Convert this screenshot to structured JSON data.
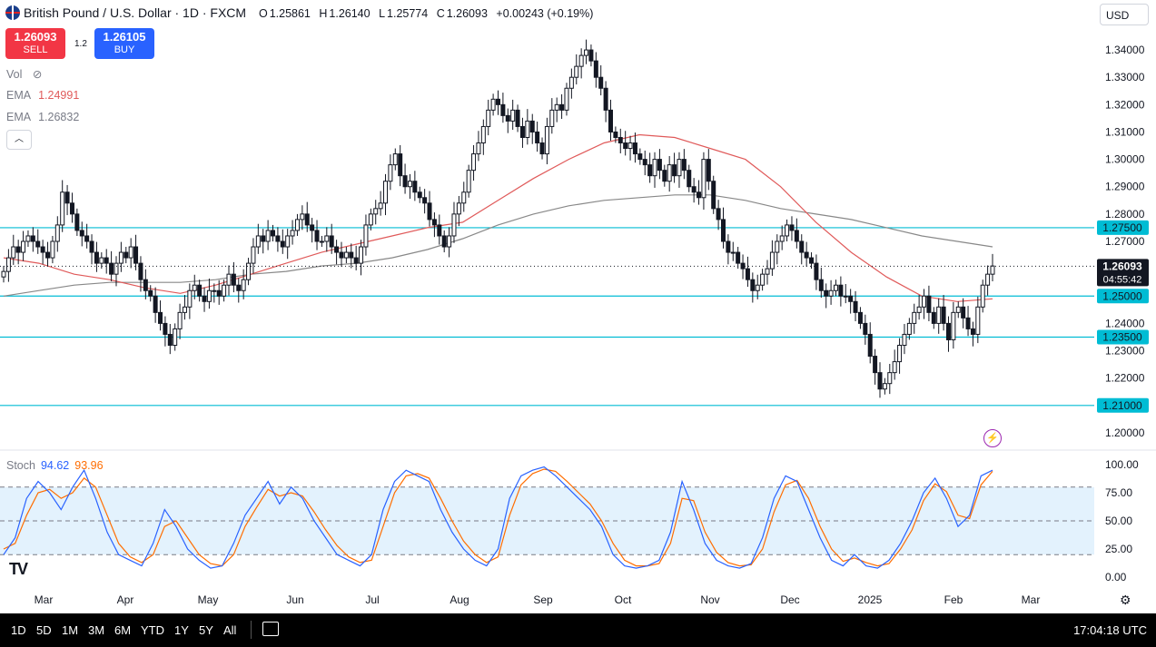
{
  "header": {
    "symbol_title": "British Pound / U.S. Dollar · 1D · FXCM",
    "open_label": "O",
    "open": "1.25861",
    "high_label": "H",
    "high": "1.26140",
    "low_label": "L",
    "low": "1.25774",
    "close_label": "C",
    "close": "1.26093",
    "change": "+0.00243 (+0.19%)"
  },
  "trade": {
    "sell_price": "1.26093",
    "sell_label": "SELL",
    "spread": "1.2",
    "buy_price": "1.26105",
    "buy_label": "BUY"
  },
  "indicators": {
    "vol_label": "Vol",
    "ema1_label": "EMA",
    "ema1_value": "1.24991",
    "ema2_label": "EMA",
    "ema2_value": "1.26832"
  },
  "currency": "USD",
  "stoch": {
    "label": "Stoch",
    "k": "94.62",
    "d": "93.96"
  },
  "price_tag": {
    "price": "1.26093",
    "countdown": "04:55:42"
  },
  "bottombar": {
    "ranges": [
      "1D",
      "5D",
      "1M",
      "3M",
      "6M",
      "YTD",
      "1Y",
      "5Y",
      "All"
    ],
    "clock": "17:04:18 UTC"
  },
  "colors": {
    "up": "#131722",
    "down": "#131722",
    "ema_fast": "#e05a5a",
    "ema_slow": "#888888",
    "hline": "#00bcd4",
    "stoch_k": "#2962ff",
    "stoch_d": "#ff6d00",
    "stoch_band": "#e3f2fd",
    "tag_bg": "#00bcd4",
    "last_bg": "#131722"
  },
  "chart_data": {
    "type": "candlestick",
    "x_labels": [
      "Mar",
      "Apr",
      "May",
      "Jun",
      "Jul",
      "Aug",
      "Sep",
      "Oct",
      "Nov",
      "Dec",
      "2025",
      "Feb",
      "Mar"
    ],
    "y_ticks": [
      "1.34000",
      "1.33000",
      "1.32000",
      "1.31000",
      "1.30000",
      "1.29000",
      "1.28000",
      "1.27000",
      "1.26000",
      "1.25000",
      "1.24000",
      "1.23000",
      "1.22000",
      "1.21000",
      "1.20000"
    ],
    "ylim": [
      1.195,
      1.345
    ],
    "horizontal_levels": [
      {
        "value": 1.275,
        "label": "1.27500"
      },
      {
        "value": 1.25,
        "label": "1.25000"
      },
      {
        "value": 1.235,
        "label": "1.23500"
      },
      {
        "value": 1.21,
        "label": "1.21000"
      }
    ],
    "close_path": [
      1.259,
      1.264,
      1.268,
      1.266,
      1.27,
      1.272,
      1.27,
      1.268,
      1.266,
      1.264,
      1.27,
      1.276,
      1.288,
      1.284,
      1.28,
      1.274,
      1.272,
      1.27,
      1.266,
      1.262,
      1.264,
      1.262,
      1.258,
      1.262,
      1.266,
      1.264,
      1.268,
      1.262,
      1.256,
      1.252,
      1.25,
      1.244,
      1.24,
      1.236,
      1.232,
      1.238,
      1.244,
      1.246,
      1.252,
      1.254,
      1.25,
      1.248,
      1.252,
      1.252,
      1.25,
      1.254,
      1.258,
      1.254,
      1.252,
      1.256,
      1.262,
      1.268,
      1.272,
      1.27,
      1.274,
      1.272,
      1.27,
      1.268,
      1.272,
      1.274,
      1.278,
      1.28,
      1.276,
      1.274,
      1.27,
      1.27,
      1.272,
      1.268,
      1.266,
      1.264,
      1.266,
      1.264,
      1.262,
      1.268,
      1.276,
      1.28,
      1.282,
      1.284,
      1.292,
      1.298,
      1.302,
      1.294,
      1.29,
      1.292,
      1.288,
      1.286,
      1.284,
      1.278,
      1.276,
      1.272,
      1.268,
      1.272,
      1.28,
      1.284,
      1.288,
      1.296,
      1.302,
      1.306,
      1.312,
      1.318,
      1.322,
      1.32,
      1.316,
      1.314,
      1.318,
      1.312,
      1.308,
      1.314,
      1.31,
      1.306,
      1.302,
      1.312,
      1.318,
      1.32,
      1.318,
      1.326,
      1.33,
      1.334,
      1.338,
      1.34,
      1.336,
      1.33,
      1.326,
      1.318,
      1.31,
      1.308,
      1.306,
      1.304,
      1.306,
      1.302,
      1.3,
      1.298,
      1.294,
      1.3,
      1.296,
      1.292,
      1.298,
      1.294,
      1.3,
      1.296,
      1.29,
      1.288,
      1.286,
      1.3,
      1.292,
      1.282,
      1.278,
      1.27,
      1.266,
      1.266,
      1.262,
      1.26,
      1.256,
      1.252,
      1.254,
      1.258,
      1.26,
      1.266,
      1.27,
      1.272,
      1.276,
      1.274,
      1.27,
      1.266,
      1.264,
      1.262,
      1.256,
      1.252,
      1.25,
      1.252,
      1.254,
      1.25,
      1.25,
      1.248,
      1.244,
      1.24,
      1.236,
      1.228,
      1.222,
      1.216,
      1.218,
      1.222,
      1.226,
      1.232,
      1.236,
      1.24,
      1.244,
      1.246,
      1.25,
      1.244,
      1.24,
      1.246,
      1.24,
      1.234,
      1.244,
      1.246,
      1.242,
      1.238,
      1.236,
      1.246,
      1.254,
      1.258,
      1.261
    ],
    "ema_fast_path": [
      1.264,
      1.262,
      1.258,
      1.256,
      1.253,
      1.251,
      1.254,
      1.258,
      1.262,
      1.266,
      1.269,
      1.272,
      1.275,
      1.277,
      1.285,
      1.293,
      1.3,
      1.306,
      1.309,
      1.308,
      1.304,
      1.3,
      1.29,
      1.277,
      1.266,
      1.257,
      1.25,
      1.248,
      1.249
    ],
    "ema_slow_path": [
      1.25,
      1.252,
      1.254,
      1.255,
      1.255,
      1.255,
      1.256,
      1.258,
      1.259,
      1.261,
      1.262,
      1.264,
      1.267,
      1.271,
      1.276,
      1.28,
      1.283,
      1.285,
      1.286,
      1.287,
      1.287,
      1.285,
      1.282,
      1.28,
      1.278,
      1.275,
      1.272,
      1.27,
      1.268
    ],
    "stochastic": {
      "ylim": [
        0,
        100
      ],
      "y_ticks": [
        "100.00",
        "75.00",
        "50.00",
        "25.00",
        "0.00"
      ],
      "bands": [
        80,
        50,
        20
      ],
      "k_path": [
        20,
        35,
        70,
        85,
        75,
        60,
        80,
        95,
        70,
        40,
        20,
        15,
        10,
        30,
        60,
        45,
        25,
        15,
        8,
        10,
        30,
        55,
        70,
        85,
        65,
        80,
        70,
        50,
        35,
        20,
        15,
        10,
        20,
        60,
        85,
        95,
        90,
        85,
        60,
        40,
        25,
        15,
        10,
        25,
        70,
        90,
        95,
        98,
        90,
        80,
        70,
        60,
        45,
        20,
        10,
        8,
        10,
        15,
        40,
        85,
        60,
        30,
        15,
        10,
        8,
        12,
        35,
        70,
        90,
        85,
        60,
        35,
        15,
        10,
        20,
        10,
        8,
        15,
        30,
        50,
        75,
        88,
        70,
        45,
        55,
        90,
        95
      ],
      "d_path": [
        25,
        30,
        55,
        75,
        78,
        70,
        75,
        88,
        80,
        55,
        30,
        18,
        13,
        20,
        45,
        50,
        35,
        20,
        12,
        10,
        20,
        45,
        62,
        78,
        72,
        75,
        72,
        58,
        42,
        28,
        18,
        13,
        15,
        45,
        75,
        90,
        92,
        88,
        70,
        50,
        32,
        20,
        13,
        18,
        55,
        82,
        92,
        96,
        94,
        85,
        75,
        65,
        50,
        30,
        15,
        10,
        10,
        12,
        30,
        70,
        68,
        40,
        22,
        13,
        10,
        11,
        25,
        58,
        82,
        86,
        70,
        45,
        25,
        14,
        17,
        13,
        10,
        12,
        25,
        42,
        68,
        83,
        76,
        55,
        52,
        82,
        94
      ]
    }
  }
}
